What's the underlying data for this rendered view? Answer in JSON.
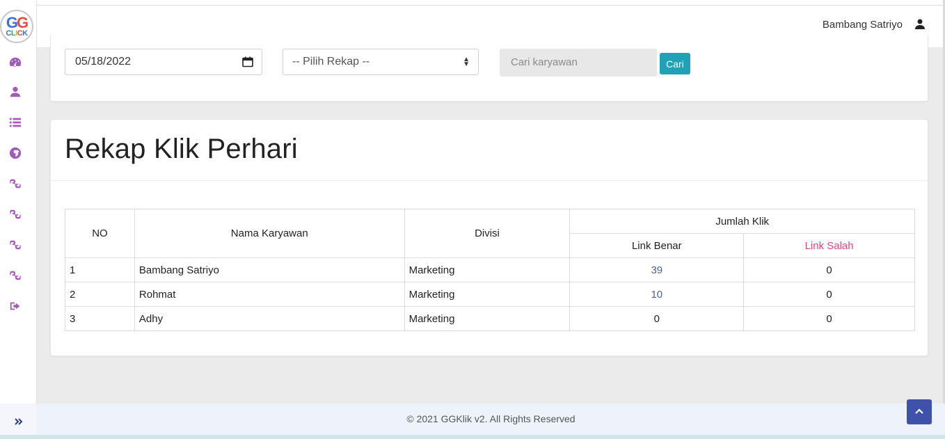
{
  "brand": {
    "logo_top_1": "G",
    "logo_top_2": "G",
    "logo_bottom": [
      "C",
      "L",
      "I",
      "C",
      "K"
    ]
  },
  "sidebar": {
    "items": [
      {
        "icon": "dashboard-icon"
      },
      {
        "icon": "user-icon"
      },
      {
        "icon": "list-icon"
      },
      {
        "icon": "globe-icon"
      },
      {
        "icon": "link-icon"
      },
      {
        "icon": "link-icon"
      },
      {
        "icon": "link-icon"
      },
      {
        "icon": "link-icon"
      },
      {
        "icon": "logout-icon"
      }
    ],
    "expand_icon": "double-chevron-right-icon"
  },
  "header": {
    "user_name": "Bambang Satriyo",
    "user_icon": "user-icon"
  },
  "filter": {
    "date_value": "05/18/2022",
    "rekap_select": "-- Pilih Rekap --",
    "search_placeholder": "Cari karyawan",
    "search_button": "Cari"
  },
  "rekap": {
    "title": "Rekap Klik Perhari",
    "headers": {
      "no": "NO",
      "nama": "Nama Karyawan",
      "divisi": "Divisi",
      "jumlah": "Jumlah Klik",
      "benar": "Link Benar",
      "salah": "Link Salah"
    },
    "rows": [
      {
        "no": "1",
        "nama": "Bambang Satriyo",
        "divisi": "Marketing",
        "benar": "39",
        "salah": "0"
      },
      {
        "no": "2",
        "nama": "Rohmat",
        "divisi": "Marketing",
        "benar": "10",
        "salah": "0"
      },
      {
        "no": "3",
        "nama": "Adhy",
        "divisi": "Marketing",
        "benar": "0",
        "salah": "0"
      }
    ]
  },
  "footer": {
    "text": "© 2021 GGKlik v2. All Rights Reserved"
  },
  "colors": {
    "accent": "#a259b7",
    "button": "#1fa2b8",
    "link": "#4a5fa8",
    "danger": "#e0487a",
    "scroll_top": "#3f51a8"
  }
}
